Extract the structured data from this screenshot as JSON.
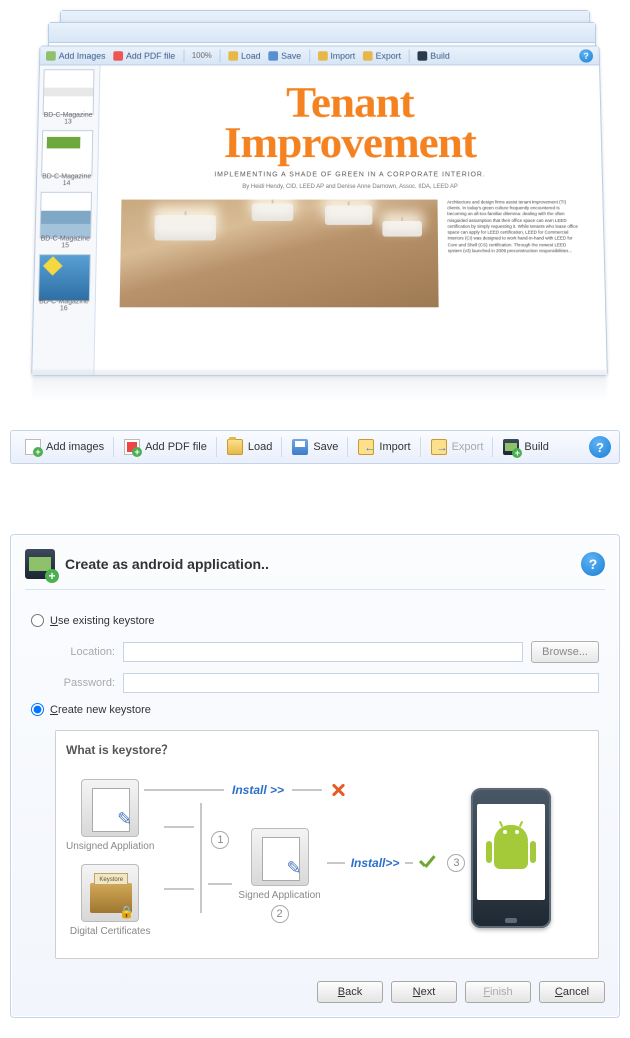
{
  "app_window": {
    "toolbar_small": {
      "add_images": "Add Images",
      "add_pdf": "Add PDF file",
      "load": "Load",
      "save": "Save",
      "import": "Import",
      "export": "Export",
      "build": "Build"
    },
    "zoom": "100%",
    "thumbnails": [
      {
        "caption": "BD-C-Magazine 13"
      },
      {
        "caption": "BD-C-Magazine 14"
      },
      {
        "caption": "BD-C-Magazine 15"
      },
      {
        "caption": "BD-C-Magazine 16"
      }
    ],
    "page": {
      "headline_line1": "Tenant",
      "headline_line2": "Improvement",
      "subhead": "IMPLEMENTING A SHADE OF GREEN IN A CORPORATE INTERIOR.",
      "byline": "By Heidi Hendy, CID, LEED AP and Denise Anne Darnown, Assoc. IIDA, LEED AP",
      "body": "Architecture and design firms assist tenant improvement (TI) clients. In today's green culture frequently encountered is becoming an all-too-familiar dilemma: dealing with the often misguided assumption that their office space can earn LEED certification by simply requesting it. While tenants who lease office space can apply for LEED certification, LEED for Commercial Interiors (CI) was designed to work hand-in-hand with LEED for Core and Shell (CS) certification. Through the newest LEED system (v3) launched in 2009 preconstruction responsibilities..."
    }
  },
  "toolbar": {
    "add_images": "Add images",
    "add_pdf": "Add PDF file",
    "load": "Load",
    "save": "Save",
    "import": "Import",
    "export": "Export",
    "build": "Build"
  },
  "dialog": {
    "title": "Create as android application..",
    "radio_existing_pre": "U",
    "radio_existing_post": "se existing keystore",
    "radio_create_pre": "C",
    "radio_create_post": "reate new keystore",
    "location_label": "Location:",
    "password_label": "Password:",
    "browse": "Browse...",
    "keystore_title": "What is keystore？",
    "labels": {
      "unsigned": "Unsigned Appliation",
      "certs": "Digital Certificates",
      "certs_tag": "Keystore",
      "signed": "Signed Application",
      "install": "Install",
      "install_suffix": ">>"
    },
    "steps": {
      "s1": "1",
      "s2": "2",
      "s3": "3"
    },
    "buttons": {
      "back_pre": "B",
      "back_post": "ack",
      "next_pre": "N",
      "next_post": "ext",
      "finish_pre": "F",
      "finish_post": "inish",
      "cancel_pre": "C",
      "cancel_post": "ancel"
    }
  }
}
